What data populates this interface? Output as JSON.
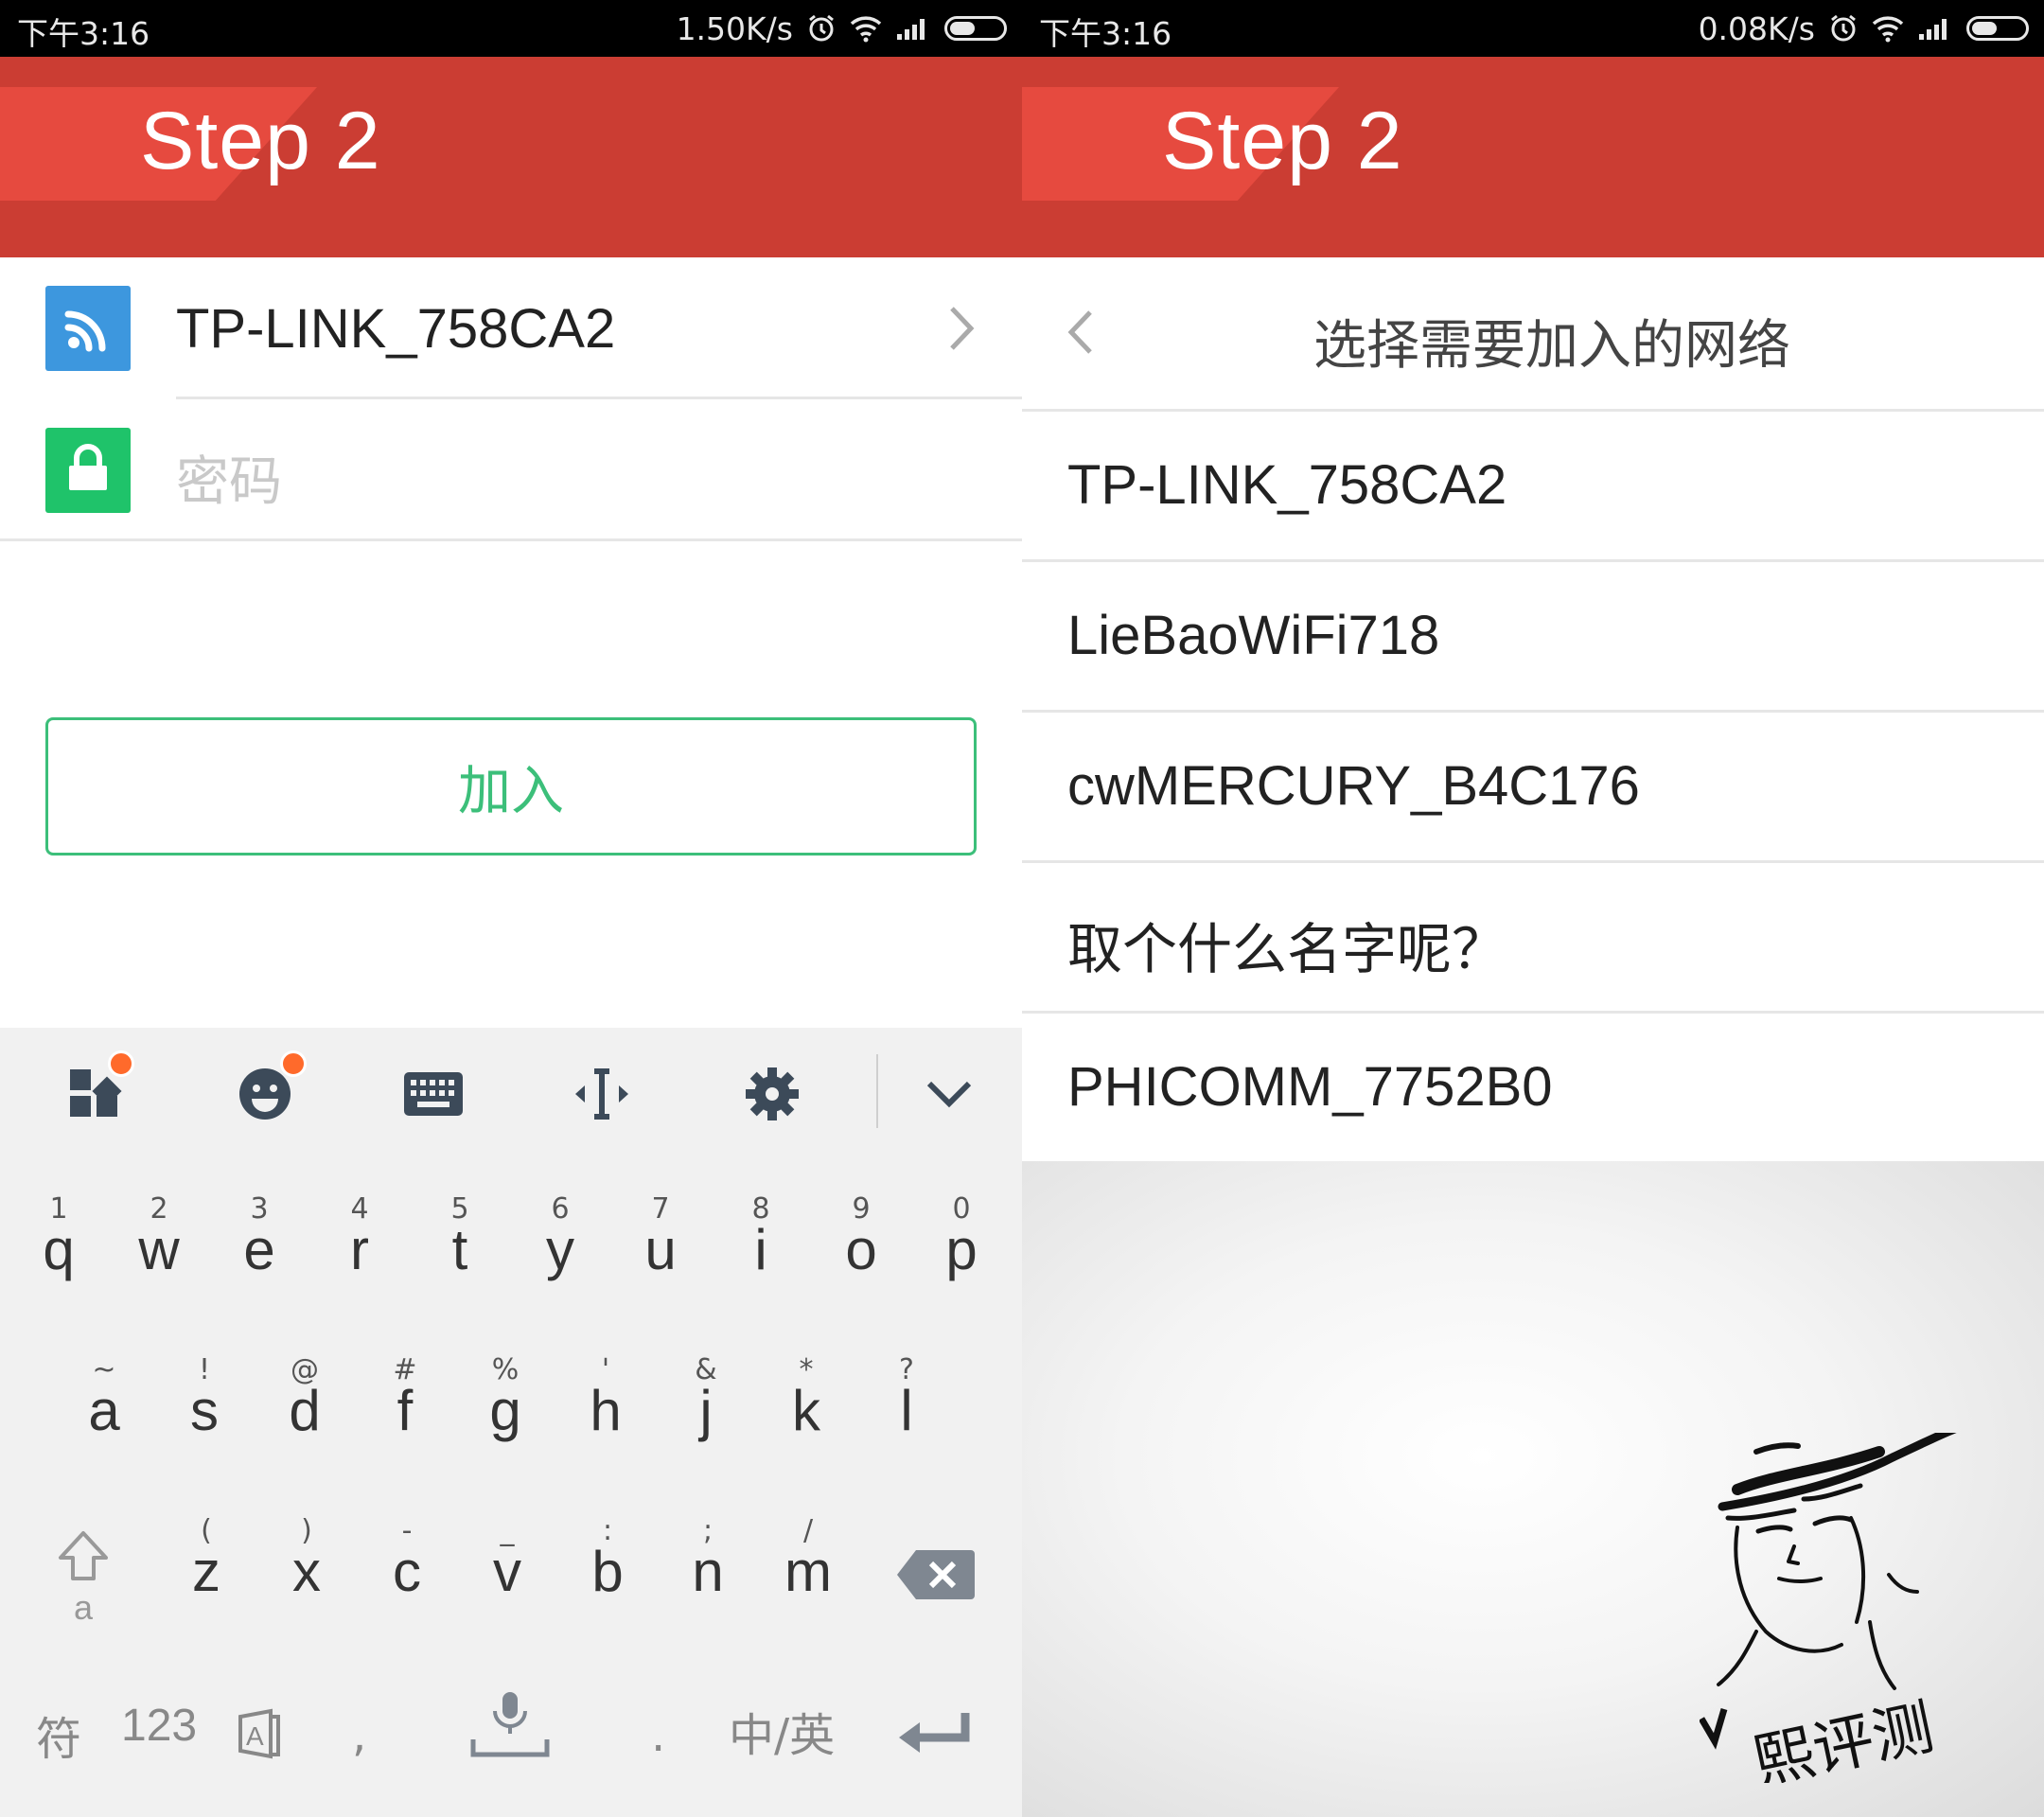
{
  "left": {
    "status": {
      "time": "下午3:16",
      "speed": "1.50K/s"
    },
    "header": {
      "title": "Step 2"
    },
    "wifi_name": "TP-LINK_758CA2",
    "password_placeholder": "密码",
    "join_label": "加入",
    "keyboard": {
      "row1": [
        {
          "sub": "1",
          "main": "q"
        },
        {
          "sub": "2",
          "main": "w"
        },
        {
          "sub": "3",
          "main": "e"
        },
        {
          "sub": "4",
          "main": "r"
        },
        {
          "sub": "5",
          "main": "t"
        },
        {
          "sub": "6",
          "main": "y"
        },
        {
          "sub": "7",
          "main": "u"
        },
        {
          "sub": "8",
          "main": "i"
        },
        {
          "sub": "9",
          "main": "o"
        },
        {
          "sub": "0",
          "main": "p"
        }
      ],
      "row2": [
        {
          "sub": "~",
          "main": "a"
        },
        {
          "sub": "!",
          "main": "s"
        },
        {
          "sub": "@",
          "main": "d"
        },
        {
          "sub": "#",
          "main": "f"
        },
        {
          "sub": "%",
          "main": "g"
        },
        {
          "sub": "'",
          "main": "h"
        },
        {
          "sub": "&",
          "main": "j"
        },
        {
          "sub": "*",
          "main": "k"
        },
        {
          "sub": "?",
          "main": "l"
        }
      ],
      "row3": [
        {
          "sub": "(",
          "main": "z"
        },
        {
          "sub": ")",
          "main": "x"
        },
        {
          "sub": "-",
          "main": "c"
        },
        {
          "sub": "_",
          "main": "v"
        },
        {
          "sub": ":",
          "main": "b"
        },
        {
          "sub": ";",
          "main": "n"
        },
        {
          "sub": "/",
          "main": "m"
        }
      ],
      "shift_letter": "a",
      "bottom": {
        "symbols": "符",
        "numbers": "123",
        "comma": ",",
        "period": ".",
        "lang": "中/英"
      }
    }
  },
  "right": {
    "status": {
      "time": "下午3:16",
      "speed": "0.08K/s"
    },
    "header": {
      "title": "Step 2"
    },
    "nav_title": "选择需要加入的网络",
    "networks": [
      "TP-LINK_758CA2",
      "LieBaoWiFi718",
      "cwMERCURY_B4C176",
      "取个什么名字呢？",
      "PHICOMM_7752B0"
    ],
    "watermark": "熙评测"
  },
  "colors": {
    "header": "#cb3d33",
    "header_band": "#e64a3f",
    "accent_green": "#3cbf7a",
    "wifi_blue": "#3d97de",
    "lock_green": "#1fc36a",
    "badge_orange": "#ff6a2b"
  },
  "icons": [
    "wifi-icon",
    "lock-icon",
    "chevron-right-icon",
    "chevron-left-icon",
    "alarm-icon",
    "signal-icon",
    "battery-icon",
    "apps-icon",
    "emoji-icon",
    "keyboard-icon",
    "cursor-icon",
    "gear-icon",
    "collapse-icon",
    "shift-icon",
    "backspace-icon",
    "mic-icon",
    "enter-icon"
  ]
}
